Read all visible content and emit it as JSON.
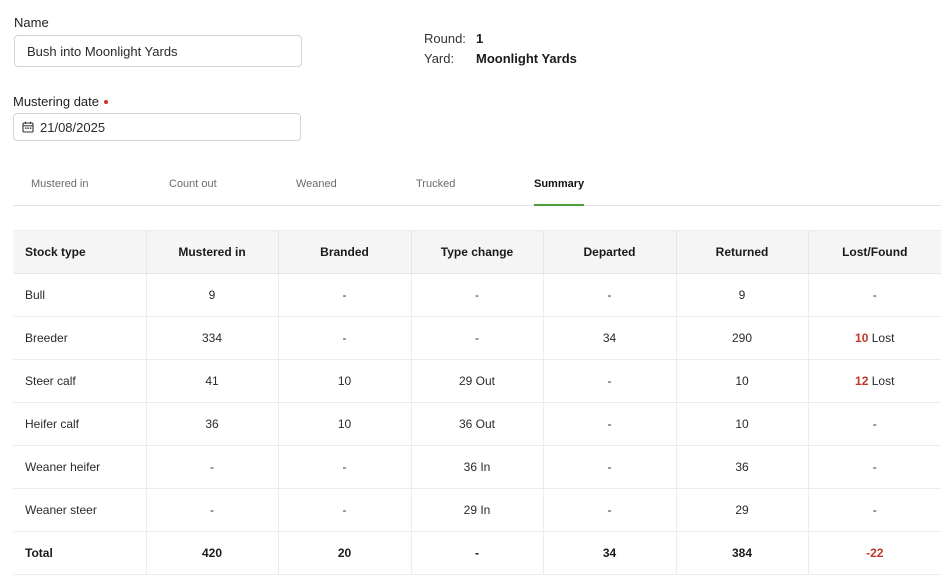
{
  "form": {
    "name_label": "Name",
    "name_value": "Bush into Moonlight Yards",
    "date_label": "Mustering date",
    "date_value": "21/08/2025"
  },
  "info": {
    "round_label": "Round:",
    "round_value": "1",
    "yard_label": "Yard:",
    "yard_value": "Moonlight Yards"
  },
  "tabs": [
    {
      "label": "Mustered in"
    },
    {
      "label": "Count out"
    },
    {
      "label": "Weaned"
    },
    {
      "label": "Trucked"
    },
    {
      "label": "Summary",
      "active": true
    }
  ],
  "table": {
    "headers": [
      "Stock type",
      "Mustered in",
      "Branded",
      "Type change",
      "Departed",
      "Returned",
      "Lost/Found"
    ],
    "rows": [
      {
        "stock_type": "Bull",
        "mustered_in": "9",
        "branded": "-",
        "type_change": "-",
        "departed": "-",
        "returned": "9",
        "lost_found_num": "",
        "lost_found_text": "-"
      },
      {
        "stock_type": "Breeder",
        "mustered_in": "334",
        "branded": "-",
        "type_change": "-",
        "departed": "34",
        "returned": "290",
        "lost_found_num": "10",
        "lost_found_text": "Lost"
      },
      {
        "stock_type": "Steer calf",
        "mustered_in": "41",
        "branded": "10",
        "type_change": "29 Out",
        "departed": "-",
        "returned": "10",
        "lost_found_num": "12",
        "lost_found_text": "Lost"
      },
      {
        "stock_type": "Heifer calf",
        "mustered_in": "36",
        "branded": "10",
        "type_change": "36 Out",
        "departed": "-",
        "returned": "10",
        "lost_found_num": "",
        "lost_found_text": "-"
      },
      {
        "stock_type": "Weaner heifer",
        "mustered_in": "-",
        "branded": "-",
        "type_change": "36 In",
        "departed": "-",
        "returned": "36",
        "lost_found_num": "",
        "lost_found_text": "-"
      },
      {
        "stock_type": "Weaner steer",
        "mustered_in": "-",
        "branded": "-",
        "type_change": "29 In",
        "departed": "-",
        "returned": "29",
        "lost_found_num": "",
        "lost_found_text": "-"
      }
    ],
    "total": {
      "stock_type": "Total",
      "mustered_in": "420",
      "branded": "20",
      "type_change": "-",
      "departed": "34",
      "returned": "384",
      "lost_found": "-22"
    }
  },
  "colors": {
    "accent": "#4f9a3a",
    "lost": "#c0392b",
    "required": "#d0302b"
  },
  "icons": {
    "date": "calendar-icon"
  }
}
